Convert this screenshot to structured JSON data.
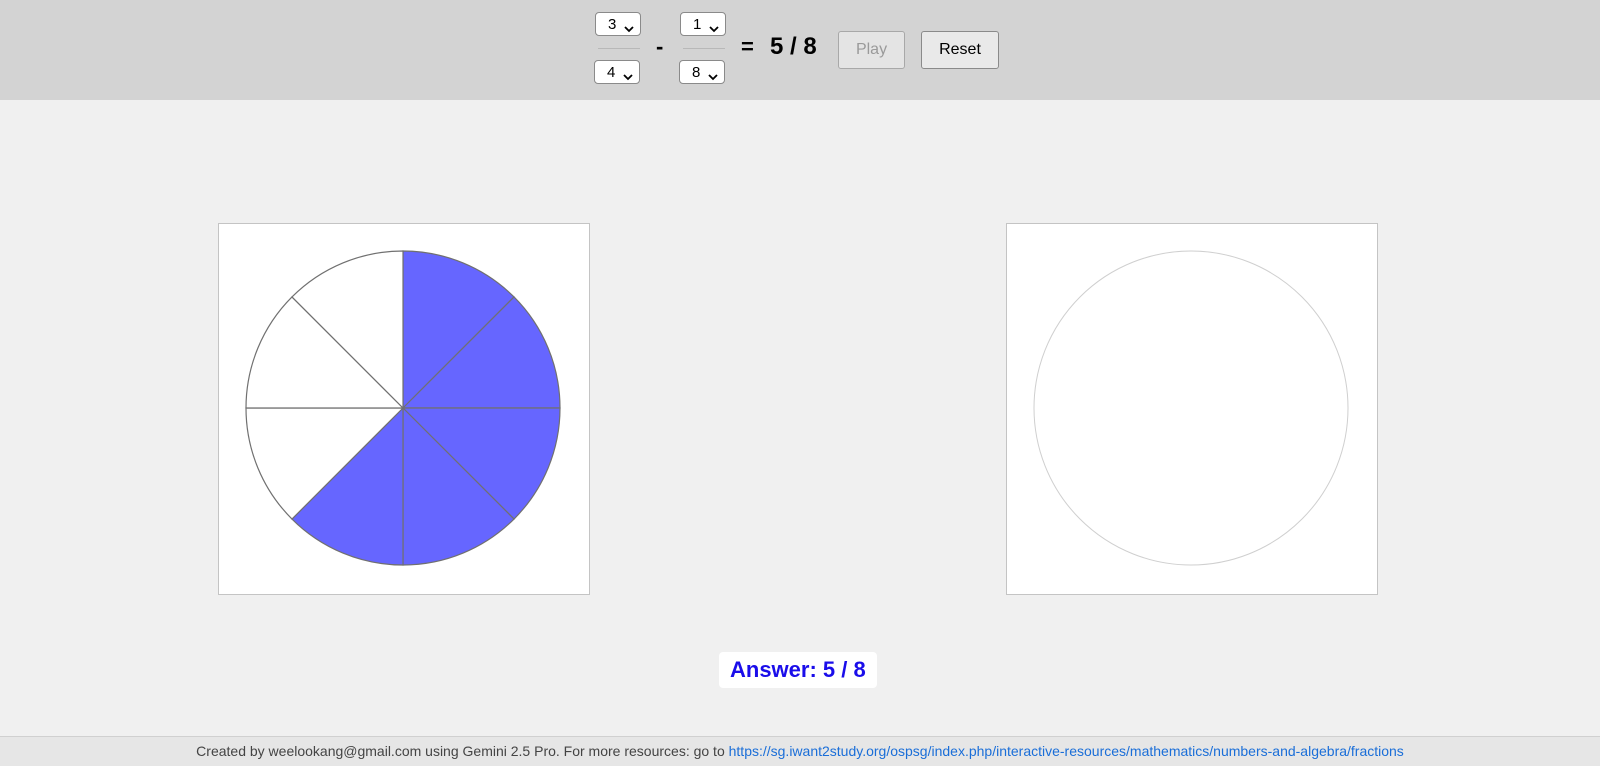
{
  "toolbar": {
    "fraction1": {
      "numerator": "3",
      "denominator": "4"
    },
    "operator": "-",
    "fraction2": {
      "numerator": "1",
      "denominator": "8"
    },
    "equals": "=",
    "result": "5 / 8",
    "play_label": "Play",
    "reset_label": "Reset"
  },
  "pies": {
    "left": {
      "denominator": 8,
      "filled_slices": [
        0,
        1,
        2,
        3,
        4
      ]
    },
    "right": {
      "denominator": 0,
      "filled_slices": []
    }
  },
  "answer": "Answer: 5 / 8",
  "footer": {
    "text": "Created by weelookang@gmail.com using Gemini 2.5 Pro. For more resources: go to ",
    "link": "https://sg.iwant2study.org/ospsg/index.php/interactive-resources/mathematics/numbers-and-algebra/fractions"
  },
  "colors": {
    "fill": "#6666ff",
    "answer_text": "#1a0dea",
    "link": "#1a6ed8"
  }
}
